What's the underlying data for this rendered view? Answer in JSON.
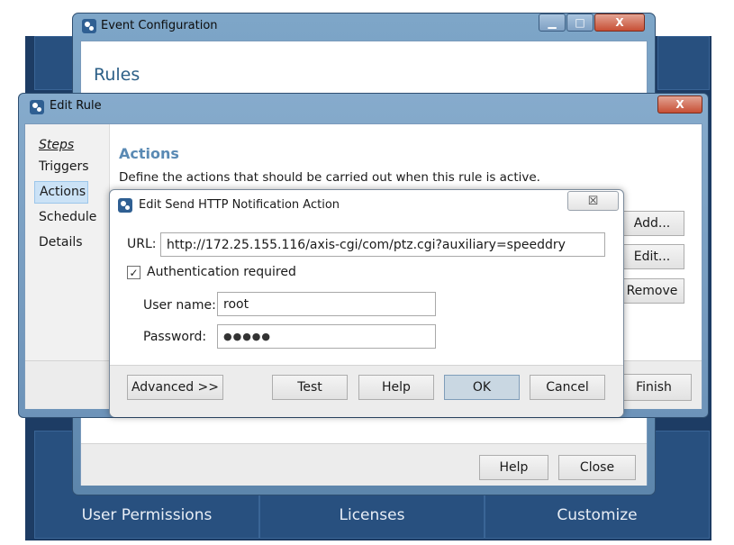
{
  "background_app": {
    "tiles": [
      "User Permissions",
      "Licenses",
      "Customize"
    ]
  },
  "event_config": {
    "title": "Event Configuration",
    "heading": "Rules",
    "controls": {
      "minimize": "▁",
      "maximize": "□",
      "close": "X"
    },
    "buttons": {
      "help": "Help",
      "close": "Close"
    }
  },
  "edit_rule": {
    "title": "Edit Rule",
    "close": "X",
    "steps_header": "Steps",
    "steps": [
      "Triggers",
      "Actions",
      "Schedule",
      "Details"
    ],
    "selected_step": "Actions",
    "heading": "Actions",
    "description": "Define the actions that should be carried out when this rule is active.",
    "buttons": {
      "add": "Add...",
      "edit": "Edit...",
      "remove": "Remove",
      "finish": "Finish"
    }
  },
  "http_dialog": {
    "title": "Edit Send HTTP Notification Action",
    "close": "☒",
    "url_label": "URL:",
    "url_value": "http://172.25.155.116/axis-cgi/com/ptz.cgi?auxiliary=speeddry",
    "auth_checkbox_label": "Authentication required",
    "auth_checked": true,
    "username_label": "User name:",
    "username_value": "root",
    "password_label": "Password:",
    "password_value": "●●●●●",
    "buttons": {
      "advanced": "Advanced >>",
      "test": "Test",
      "help": "Help",
      "ok": "OK",
      "cancel": "Cancel"
    }
  },
  "colors": {
    "accent": "#2c5f87",
    "window_frame": "#6d93b9",
    "background_app": "#1d3c64"
  }
}
